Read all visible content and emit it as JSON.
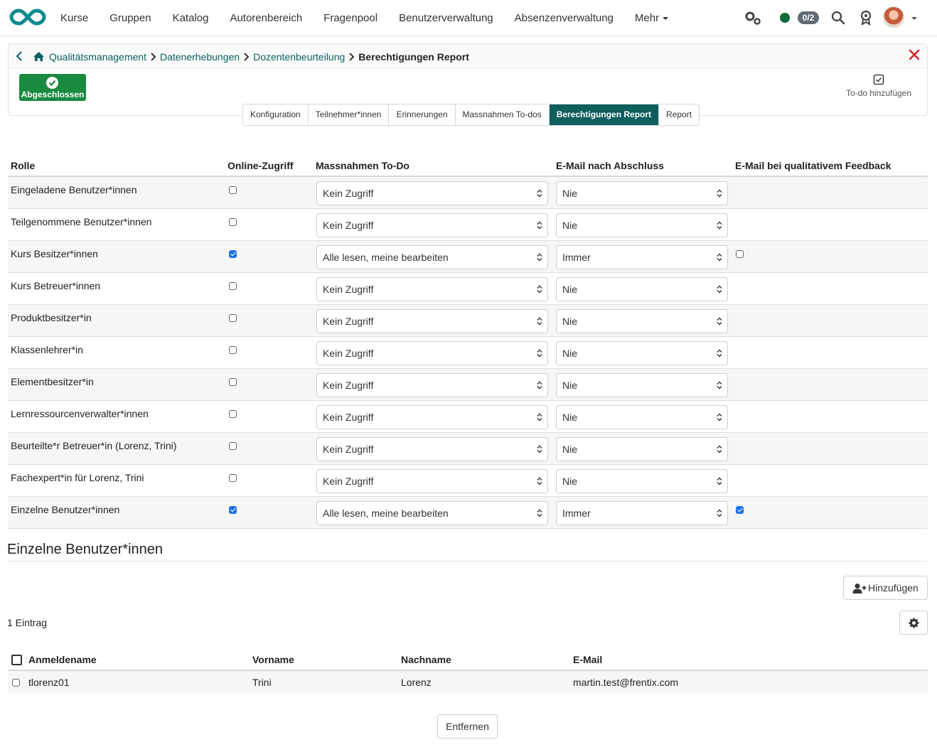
{
  "nav": {
    "links": [
      "Kurse",
      "Gruppen",
      "Katalog",
      "Autorenbereich",
      "Fragenpool",
      "Benutzerverwaltung",
      "Absenzenverwaltung"
    ],
    "more_label": "Mehr",
    "online_count": "0/2"
  },
  "breadcrumb": {
    "items": [
      "Qualitätsmanagement",
      "Datenerhebungen",
      "Dozentenbeurteilung"
    ],
    "current": "Berechtigungen Report"
  },
  "status": {
    "label": "Abgeschlossen"
  },
  "todo_add_label": "To-do hinzufügen",
  "tabs": [
    "Konfiguration",
    "Teilnehmer*innen",
    "Erinnerungen",
    "Massnahmen To-dos",
    "Berechtigungen Report",
    "Report"
  ],
  "active_tab": "Berechtigungen Report",
  "roles_table": {
    "headers": {
      "role": "Rolle",
      "online": "Online-Zugriff",
      "todo": "Massnahmen To-Do",
      "email_done": "E-Mail nach Abschluss",
      "email_feedback": "E-Mail bei qualitativem Feedback"
    },
    "rows": [
      {
        "role": "Eingeladene Benutzer*innen",
        "online": false,
        "todo": "Kein Zugriff",
        "email": "Nie",
        "feedback": null
      },
      {
        "role": "Teilgenommene Benutzer*innen",
        "online": false,
        "todo": "Kein Zugriff",
        "email": "Nie",
        "feedback": null
      },
      {
        "role": "Kurs Besitzer*innen",
        "online": true,
        "todo": "Alle lesen, meine bearbeiten",
        "email": "Immer",
        "feedback": false
      },
      {
        "role": "Kurs Betreuer*innen",
        "online": false,
        "todo": "Kein Zugriff",
        "email": "Nie",
        "feedback": null
      },
      {
        "role": "Produktbesitzer*in",
        "online": false,
        "todo": "Kein Zugriff",
        "email": "Nie",
        "feedback": null
      },
      {
        "role": "Klassenlehrer*in",
        "online": false,
        "todo": "Kein Zugriff",
        "email": "Nie",
        "feedback": null
      },
      {
        "role": "Elementbesitzer*in",
        "online": false,
        "todo": "Kein Zugriff",
        "email": "Nie",
        "feedback": null
      },
      {
        "role": "Lernressourcenverwalter*innen",
        "online": false,
        "todo": "Kein Zugriff",
        "email": "Nie",
        "feedback": null
      },
      {
        "role": "Beurteilte*r Betreuer*in (Lorenz, Trini)",
        "online": false,
        "todo": "Kein Zugriff",
        "email": "Nie",
        "feedback": null
      },
      {
        "role": "Fachexpert*in für Lorenz, Trini",
        "online": false,
        "todo": "Kein Zugriff",
        "email": "Nie",
        "feedback": null
      },
      {
        "role": "Einzelne Benutzer*innen",
        "online": true,
        "todo": "Alle lesen, meine bearbeiten",
        "email": "Immer",
        "feedback": true
      }
    ]
  },
  "users_section": {
    "title": "Einzelne Benutzer*innen",
    "add_label": "Hinzufügen",
    "entry_count": "1 Eintrag",
    "headers": {
      "login": "Anmeldename",
      "first": "Vorname",
      "last": "Nachname",
      "email": "E-Mail"
    },
    "rows": [
      {
        "login": "tlorenz01",
        "first": "Trini",
        "last": "Lorenz",
        "email": "martin.test@frentix.com"
      }
    ],
    "remove_label": "Entfernen"
  },
  "colors": {
    "brand": "#0b8a8f",
    "active_tab": "#0e5f5d",
    "status_green": "#1a8a3e",
    "link": "#0b6163",
    "close_red": "#d9262c"
  },
  "icons": [
    "infinity-logo",
    "gears-icon",
    "search-icon",
    "award-icon",
    "home-icon",
    "close-icon",
    "chevron-left-icon",
    "todo-check-icon",
    "user-plus-icon",
    "gear-icon"
  ]
}
